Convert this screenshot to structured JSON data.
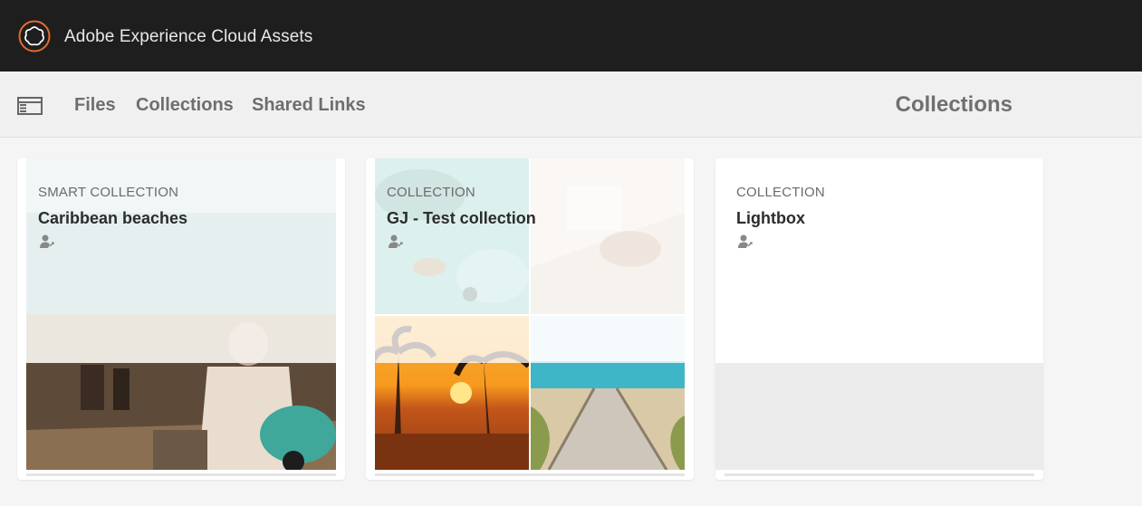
{
  "header": {
    "app_title": "Adobe Experience Cloud Assets",
    "logo_icon": "adobe-experience-cloud-logo",
    "accent_color": "#e46b2b"
  },
  "nav": {
    "rail_icon": "side-rail-toggle-icon",
    "links": [
      {
        "label": "Files"
      },
      {
        "label": "Collections"
      },
      {
        "label": "Shared Links"
      }
    ],
    "page_title": "Collections"
  },
  "cards": [
    {
      "type": "SMART COLLECTION",
      "title": "Caribbean beaches",
      "owner_icon": "user-shared-icon"
    },
    {
      "type": "COLLECTION",
      "title": "GJ - Test collection",
      "owner_icon": "user-shared-icon"
    },
    {
      "type": "COLLECTION",
      "title": "Lightbox",
      "owner_icon": "user-shared-icon"
    }
  ]
}
